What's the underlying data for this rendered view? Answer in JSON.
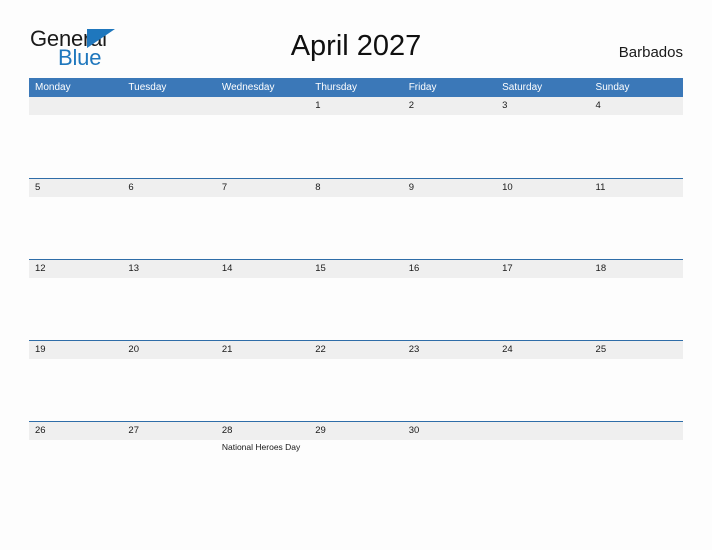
{
  "brand": {
    "word_one": "General",
    "word_two": "Blue",
    "flag_icon": "triangle-flag-icon",
    "accent_color": "#1f77bd"
  },
  "header": {
    "title": "April 2027",
    "region": "Barbados"
  },
  "theme": {
    "header_blue": "#3b78b8",
    "rule_blue": "#2f6da8",
    "strip_gray": "#efefef",
    "cell_white": "#fdfdfd",
    "text_dark": "#1a1a1a"
  },
  "calendar": {
    "weekdays": [
      "Monday",
      "Tuesday",
      "Wednesday",
      "Thursday",
      "Friday",
      "Saturday",
      "Sunday"
    ],
    "weeks": [
      [
        {
          "date": "",
          "event": ""
        },
        {
          "date": "",
          "event": ""
        },
        {
          "date": "",
          "event": ""
        },
        {
          "date": "1",
          "event": ""
        },
        {
          "date": "2",
          "event": ""
        },
        {
          "date": "3",
          "event": ""
        },
        {
          "date": "4",
          "event": ""
        }
      ],
      [
        {
          "date": "5",
          "event": ""
        },
        {
          "date": "6",
          "event": ""
        },
        {
          "date": "7",
          "event": ""
        },
        {
          "date": "8",
          "event": ""
        },
        {
          "date": "9",
          "event": ""
        },
        {
          "date": "10",
          "event": ""
        },
        {
          "date": "11",
          "event": ""
        }
      ],
      [
        {
          "date": "12",
          "event": ""
        },
        {
          "date": "13",
          "event": ""
        },
        {
          "date": "14",
          "event": ""
        },
        {
          "date": "15",
          "event": ""
        },
        {
          "date": "16",
          "event": ""
        },
        {
          "date": "17",
          "event": ""
        },
        {
          "date": "18",
          "event": ""
        }
      ],
      [
        {
          "date": "19",
          "event": ""
        },
        {
          "date": "20",
          "event": ""
        },
        {
          "date": "21",
          "event": ""
        },
        {
          "date": "22",
          "event": ""
        },
        {
          "date": "23",
          "event": ""
        },
        {
          "date": "24",
          "event": ""
        },
        {
          "date": "25",
          "event": ""
        }
      ],
      [
        {
          "date": "26",
          "event": ""
        },
        {
          "date": "27",
          "event": ""
        },
        {
          "date": "28",
          "event": "National Heroes Day"
        },
        {
          "date": "29",
          "event": ""
        },
        {
          "date": "30",
          "event": ""
        },
        {
          "date": "",
          "event": ""
        },
        {
          "date": "",
          "event": ""
        }
      ]
    ]
  }
}
